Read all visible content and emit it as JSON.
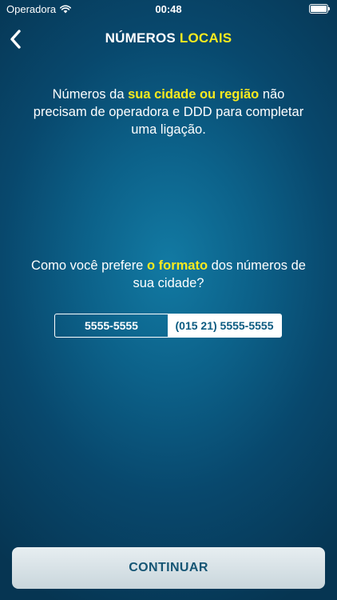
{
  "status_bar": {
    "carrier": "Operadora",
    "time": "00:48"
  },
  "nav": {
    "title_part1": "NÚMEROS",
    "title_part2": "LOCAIS"
  },
  "intro": {
    "text_before": "Números da ",
    "highlight": "sua cidade ou região",
    "text_after": " não precisam de operadora e DDD para completar uma ligação."
  },
  "question": {
    "text_before": "Como você prefere ",
    "highlight": "o formato",
    "text_after": " dos números de sua cidade?"
  },
  "format_toggle": {
    "options": [
      "5555-5555",
      "(015 21) 5555-5555"
    ],
    "selected": "(015 21) 5555-5555"
  },
  "continue_button": {
    "label": "CONTINUAR"
  },
  "colors": {
    "accent_yellow": "#f9ea1f",
    "background": "#0c6189",
    "button_text": "#155574"
  },
  "icons": {
    "back": "chevron-left-icon",
    "wifi": "wifi-icon",
    "battery": "battery-icon"
  }
}
